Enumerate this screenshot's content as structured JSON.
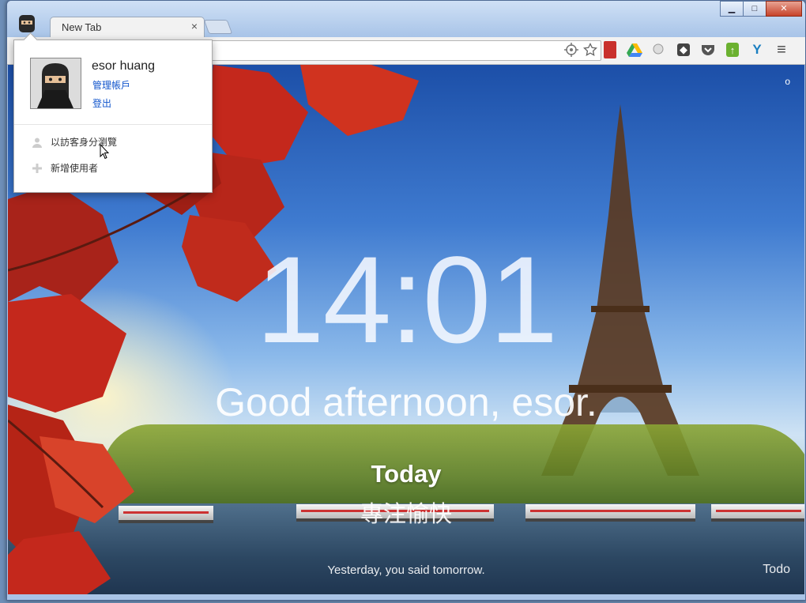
{
  "window": {
    "minimize_glyph": "▁",
    "maximize_glyph": "□",
    "close_glyph": "✕"
  },
  "tab": {
    "title": "New Tab",
    "close_glyph": "×"
  },
  "toolbar": {
    "omnibox_value": "",
    "extensions": [
      "red-bookmark-icon",
      "google-drive-icon",
      "search-extension-icon",
      "puzzle-extension-icon",
      "pocket-icon",
      "evernote-icon",
      "y-extension-icon",
      "menu-icon"
    ],
    "menu_glyph": "≡"
  },
  "profile_menu": {
    "name": "esor huang",
    "manage_link": "管理帳戶",
    "signout_link": "登出",
    "guest_browse": "以訪客身分瀏覽",
    "add_user": "新增使用者"
  },
  "momentum": {
    "clock": "14:01",
    "greeting": "Good afternoon, esor.",
    "focus_heading": "Today",
    "focus_text": "專注愉快",
    "quote": "Yesterday, you said tomorrow.",
    "todo_label": "Todo",
    "corner_glyph": "o"
  }
}
